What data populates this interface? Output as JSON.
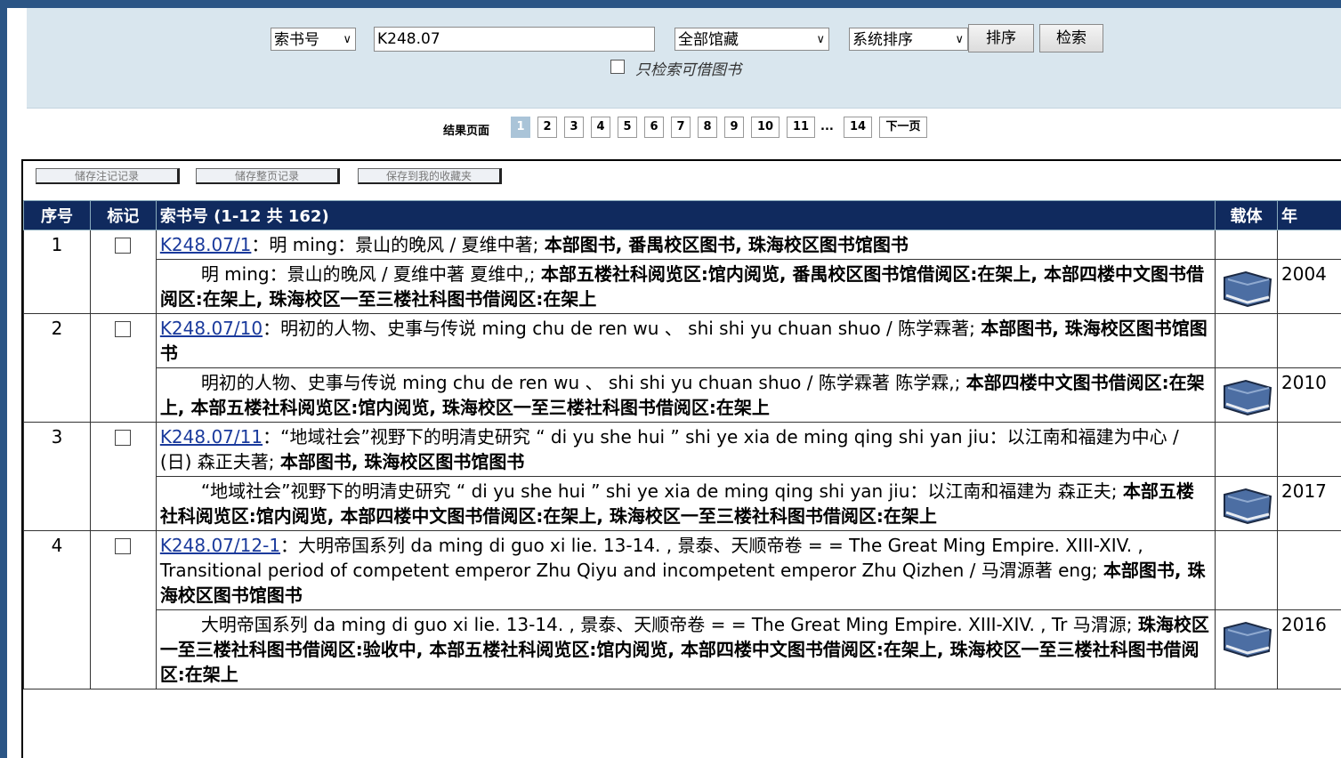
{
  "search": {
    "field_select": "索书号",
    "query": "K248.07",
    "collection_select": "全部馆藏",
    "sort_select": "系统排序",
    "sort_button": "排序",
    "search_button": "检索",
    "available_only_label": "只检索可借图书"
  },
  "pager": {
    "label": "结果页面",
    "pages": [
      "1",
      "2",
      "3",
      "4",
      "5",
      "6",
      "7",
      "8",
      "9",
      "10",
      "11"
    ],
    "ellipsis": "...",
    "last_page": "14",
    "next": "下一页"
  },
  "toolbar": {
    "save_marked": "储存注记记录",
    "save_page": "储存整页记录",
    "save_favorites": "保存到我的收藏夹"
  },
  "table": {
    "headers": {
      "num": "序号",
      "mark": "标记",
      "callno": "索书号 (1-12 共 162)",
      "media": "载体",
      "year": "年"
    },
    "rows": [
      {
        "num": "1",
        "callno": "K248.07/1",
        "title": "：明 ming：景山的晚风 / 夏维中著;",
        "title_bold": "本部图书, 番禺校区图书, 珠海校区图书馆图书",
        "sub_text": "明 ming：景山的晚风 / 夏维中著 夏维中,;",
        "sub_bold": "本部五楼社科阅览区:馆内阅览, 番禺校区图书馆借阅区:在架上, 本部四楼中文图书借阅区:在架上, 珠海校区一至三楼社科图书借阅区:在架上",
        "year": "2004"
      },
      {
        "num": "2",
        "callno": "K248.07/10",
        "title": "：明初的人物、史事与传说 ming chu de ren wu 、 shi shi yu chuan shuo / 陈学霖著;",
        "title_bold": "本部图书, 珠海校区图书馆图书",
        "sub_text": "明初的人物、史事与传说 ming chu de ren wu 、 shi shi yu chuan shuo / 陈学霖著 陈学霖,;",
        "sub_bold": "本部四楼中文图书借阅区:在架上, 本部五楼社科阅览区:馆内阅览, 珠海校区一至三楼社科图书借阅区:在架上",
        "year": "2010"
      },
      {
        "num": "3",
        "callno": "K248.07/11",
        "title": "：“地域社会”视野下的明清史研究 “ di yu she hui ” shi ye xia de ming qing shi yan jiu：以江南和福建为中心 / (日) 森正夫著;",
        "title_bold": "本部图书, 珠海校区图书馆图书",
        "sub_text": "“地域社会”视野下的明清史研究 “ di yu she hui ” shi ye xia de ming qing shi yan jiu：以江南和福建为 森正夫;",
        "sub_bold": "本部五楼社科阅览区:馆内阅览, 本部四楼中文图书借阅区:在架上, 珠海校区一至三楼社科图书借阅区:在架上",
        "year": "2017"
      },
      {
        "num": "4",
        "callno": "K248.07/12-1",
        "title": "：大明帝国系列 da ming di guo xi lie. 13-14. , 景泰、天顺帝卷 = = The Great Ming Empire. XIII-XIV. , Transitional period of competent emperor Zhu Qiyu and incompetent emperor Zhu Qizhen / 马渭源著 eng;",
        "title_bold": "本部图书, 珠海校区图书馆图书",
        "sub_text": "大明帝国系列 da ming di guo xi lie. 13-14. , 景泰、天顺帝卷 = = The Great Ming Empire. XIII-XIV. , Tr 马渭源;",
        "sub_bold": "珠海校区一至三楼社科图书借阅区:验收中, 本部五楼社科阅览区:馆内阅览, 本部四楼中文图书借阅区:在架上, 珠海校区一至三楼社科图书借阅区:在架上",
        "year": "2016"
      }
    ]
  },
  "colors": {
    "header_bg": "#102a5e",
    "frame": "#2b5585",
    "search_bg": "#d9e6ee",
    "link": "#1a3a9c"
  },
  "icons": {
    "media": "book-icon"
  }
}
